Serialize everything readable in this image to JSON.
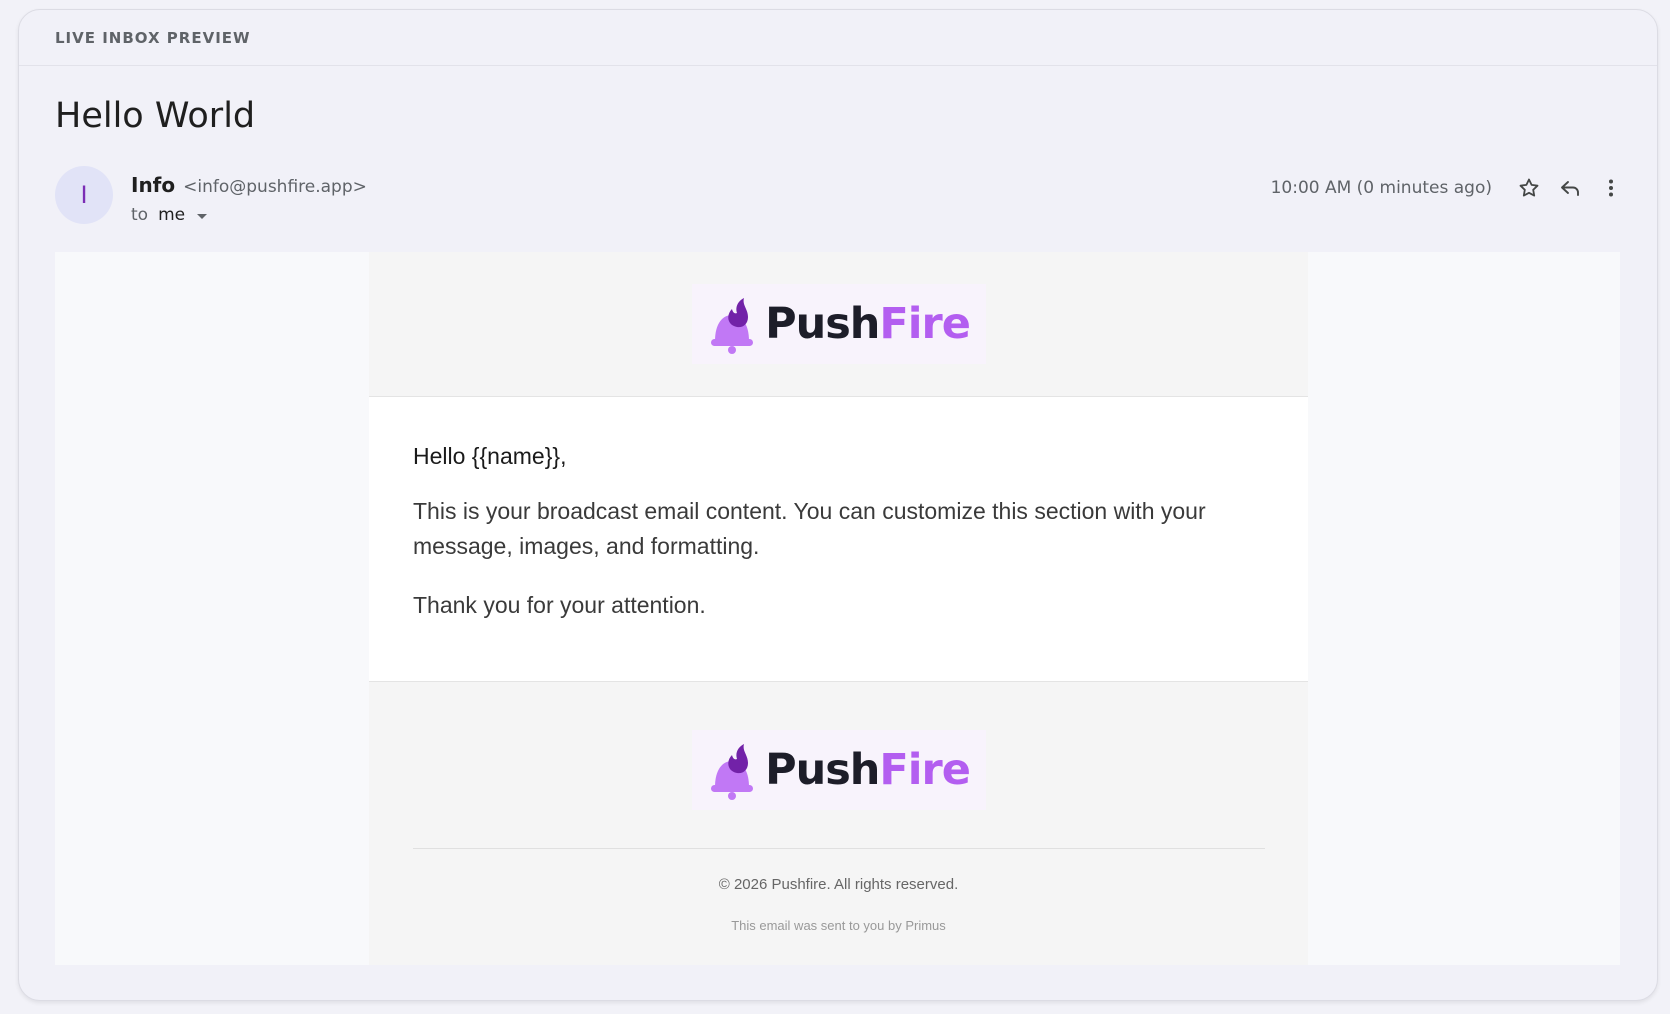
{
  "header": {
    "title": "LIVE INBOX PREVIEW"
  },
  "message": {
    "subject": "Hello World",
    "avatar_letter": "I",
    "sender_name": "Info",
    "sender_email": "<info@pushfire.app>",
    "to_label": "to",
    "recipient": "me",
    "timestamp": "10:00 AM (0 minutes ago)",
    "icons": [
      "star-icon",
      "reply-icon",
      "more-vert-icon"
    ]
  },
  "email": {
    "logo": {
      "part1": "Push",
      "part2": "Fire"
    },
    "greeting": "Hello {{name}},",
    "body": "This is your broadcast email content. You can customize this section with your message, images, and formatting.",
    "closing": "Thank you for your attention.",
    "copyright": "© 2026 Pushfire. All rights reserved.",
    "sent_by": "This email was sent to you by Primus"
  },
  "colors": {
    "brand_purple": "#b35ef0",
    "brand_dark_purple": "#7b2db5",
    "avatar_bg": "#e1e3f7"
  }
}
